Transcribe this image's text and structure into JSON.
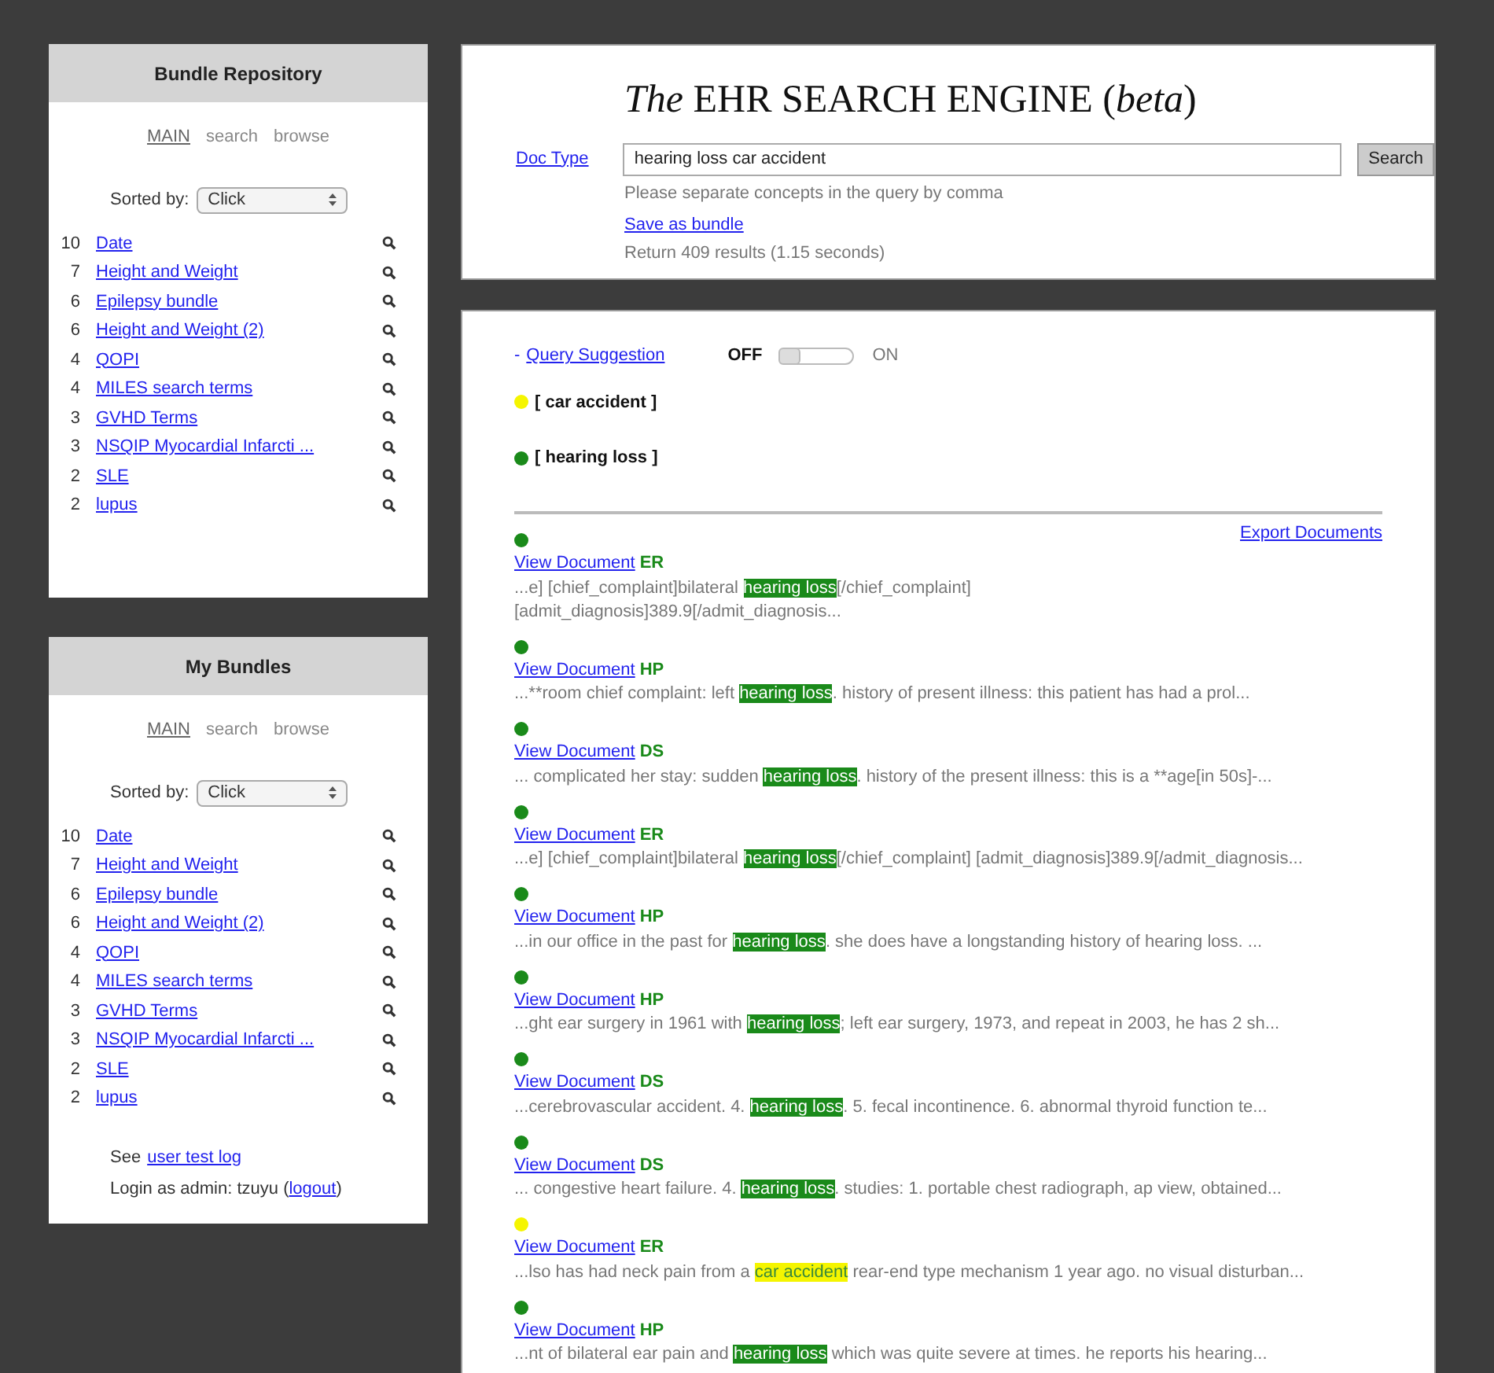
{
  "panels": [
    {
      "title": "Bundle Repository",
      "nav": [
        {
          "label": "MAIN",
          "selected": true
        },
        {
          "label": "search",
          "selected": false
        },
        {
          "label": "browse",
          "selected": false
        }
      ],
      "sort_label": "Sorted by:",
      "sort_value": "Click",
      "bundles": [
        {
          "count": "10",
          "name": "Date"
        },
        {
          "count": "7",
          "name": "Height and Weight"
        },
        {
          "count": "6",
          "name": "Epilepsy bundle"
        },
        {
          "count": "6",
          "name": "Height and Weight (2)"
        },
        {
          "count": "4",
          "name": "QOPI"
        },
        {
          "count": "4",
          "name": "MILES search terms"
        },
        {
          "count": "3",
          "name": "GVHD Terms"
        },
        {
          "count": "3",
          "name": "NSQIP Myocardial Infarcti ..."
        },
        {
          "count": "2",
          "name": "SLE"
        },
        {
          "count": "2",
          "name": "lupus"
        }
      ]
    },
    {
      "title": "My Bundles",
      "nav": [
        {
          "label": "MAIN",
          "selected": true
        },
        {
          "label": "search",
          "selected": false
        },
        {
          "label": "browse",
          "selected": false
        }
      ],
      "sort_label": "Sorted by:",
      "sort_value": "Click",
      "bundles": [
        {
          "count": "10",
          "name": "Date"
        },
        {
          "count": "7",
          "name": "Height and Weight"
        },
        {
          "count": "6",
          "name": "Epilepsy bundle"
        },
        {
          "count": "6",
          "name": "Height and Weight (2)"
        },
        {
          "count": "4",
          "name": "QOPI"
        },
        {
          "count": "4",
          "name": "MILES search terms"
        },
        {
          "count": "3",
          "name": "GVHD Terms"
        },
        {
          "count": "3",
          "name": "NSQIP Myocardial Infarcti ..."
        },
        {
          "count": "2",
          "name": "SLE"
        },
        {
          "count": "2",
          "name": "lupus"
        }
      ],
      "footer": {
        "see_label": "See",
        "log_link": "user test log",
        "login_text": "Login as admin: tzuyu (",
        "logout_link": "logout",
        "login_end": ")"
      }
    }
  ],
  "search": {
    "title": "*The* EHR SEARCH ENGINE (*beta*)",
    "doc_type": "Doc Type",
    "query": "hearing loss car accident",
    "button": "Search",
    "hint": "Please separate concepts in the query by comma",
    "save_link": "Save as bundle",
    "stats": "Return 409 results (1.15 seconds)"
  },
  "suggestion": {
    "dash": "-",
    "link": "Query Suggestion",
    "off_label": "OFF",
    "on_label": "ON",
    "on": false
  },
  "concepts": [
    {
      "label": "[ car accident ]",
      "color": "#f5f500"
    },
    {
      "label": "[ hearing loss ]",
      "color": "#1a8a1a"
    }
  ],
  "export_link": "Export Documents",
  "results": [
    {
      "color": "#1a8a1a",
      "link": "View Document",
      "doc_type": "ER",
      "before": "...e] [chief_complaint]bilateral ",
      "match": "hearing loss",
      "after": "[/chief_complaint] [admit_diagnosis]389.9[/admit_diagnosis..."
    },
    {
      "color": "#1a8a1a",
      "link": "View Document",
      "doc_type": "HP",
      "before": "...**room chief complaint: left ",
      "match": "hearing loss",
      "after": ". history of present illness: this patient has had a prol..."
    },
    {
      "color": "#1a8a1a",
      "link": "View Document",
      "doc_type": "DS",
      "before": "... complicated her stay: sudden ",
      "match": "hearing loss",
      "after": ". history of the present illness: this is a **age[in 50s]-..."
    },
    {
      "color": "#1a8a1a",
      "link": "View Document",
      "doc_type": "ER",
      "before": "...e] [chief_complaint]bilateral ",
      "match": "hearing loss",
      "after": "[/chief_complaint] [admit_diagnosis]389.9[/admit_diagnosis..."
    },
    {
      "color": "#1a8a1a",
      "link": "View Document",
      "doc_type": "HP",
      "before": "...in our office in the past for ",
      "match": "hearing loss",
      "after": ". she does have a longstanding history of hearing loss. ..."
    },
    {
      "color": "#1a8a1a",
      "link": "View Document",
      "doc_type": "HP",
      "before": "...ght ear surgery in 1961 with ",
      "match": "hearing loss",
      "after": "; left ear surgery, 1973, and repeat in 2003, he has 2 sh..."
    },
    {
      "color": "#1a8a1a",
      "link": "View Document",
      "doc_type": "DS",
      "before": "...cerebrovascular accident. 4. ",
      "match": "hearing loss",
      "after": ". 5. fecal incontinence. 6. abnormal thyroid function te..."
    },
    {
      "color": "#1a8a1a",
      "link": "View Document",
      "doc_type": "DS",
      "before": "... congestive heart failure. 4. ",
      "match": "hearing loss",
      "after": ". studies: 1. portable chest radiograph, ap view, obtained..."
    },
    {
      "color": "#f5f500",
      "link": "View Document",
      "doc_type": "ER",
      "before": "...lso has had neck pain from a ",
      "match": "car accident",
      "after": " rear-end type mechanism 1 year ago. no visual disturban..."
    },
    {
      "color": "#1a8a1a",
      "link": "View Document",
      "doc_type": "HP",
      "before": "...nt of bilateral ear pain and ",
      "match": "hearing loss",
      "after": " which was quite severe at times. he reports his hearing..."
    }
  ]
}
